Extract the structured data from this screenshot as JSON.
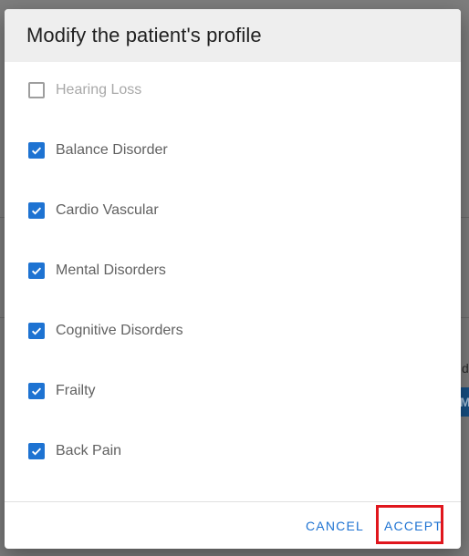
{
  "dialog": {
    "title": "Modify the patient's profile",
    "options": [
      {
        "label": "Hearing Loss",
        "checked": false,
        "disabled": true
      },
      {
        "label": "Balance Disorder",
        "checked": true,
        "disabled": false
      },
      {
        "label": "Cardio Vascular",
        "checked": true,
        "disabled": false
      },
      {
        "label": "Mental Disorders",
        "checked": true,
        "disabled": false
      },
      {
        "label": "Cognitive Disorders",
        "checked": true,
        "disabled": false
      },
      {
        "label": "Frailty",
        "checked": true,
        "disabled": false
      },
      {
        "label": "Back Pain",
        "checked": true,
        "disabled": false
      }
    ],
    "actions": {
      "cancel_label": "CANCEL",
      "accept_label": "ACCEPT"
    }
  },
  "colors": {
    "accent": "#1e73d2",
    "highlight": "#e0161d",
    "scrim": "#7d7d7d"
  },
  "icons": {
    "checked": "checkbox-checked-icon",
    "unchecked": "checkbox-unchecked-icon"
  }
}
